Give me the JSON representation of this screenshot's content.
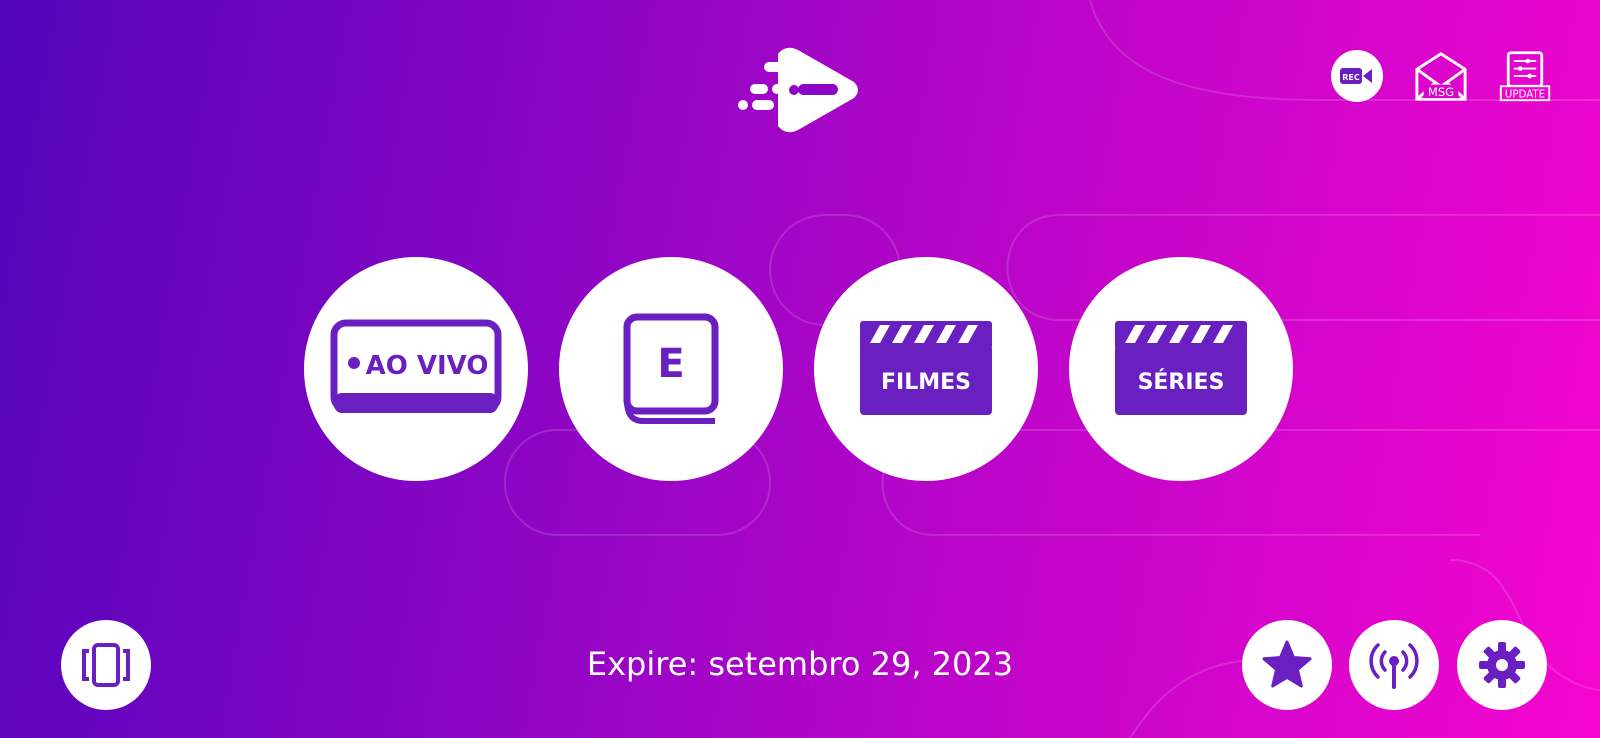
{
  "header": {
    "logo_icon": "play-arrow-logo-icon",
    "rec_label": "REC",
    "msg_label": "MSG",
    "update_label": "UPDATE"
  },
  "menu": [
    {
      "id": "live",
      "label": "AO VIVO",
      "icon": "live-tv-icon"
    },
    {
      "id": "epg",
      "label": "E",
      "icon": "epg-book-icon"
    },
    {
      "id": "movies",
      "label": "FILMES",
      "icon": "clapperboard-icon"
    },
    {
      "id": "series",
      "label": "SÉRIES",
      "icon": "clapperboard-icon"
    }
  ],
  "footer": {
    "expire_text": "Expire: setembro 29, 2023",
    "left_button_icon": "multiscreen-icon",
    "right_buttons": [
      "star-icon",
      "broadcast-icon",
      "gear-icon"
    ]
  },
  "colors": {
    "accent": "#6a1fc0",
    "gradient_start": "#5205bb",
    "gradient_end": "#f505cf"
  }
}
